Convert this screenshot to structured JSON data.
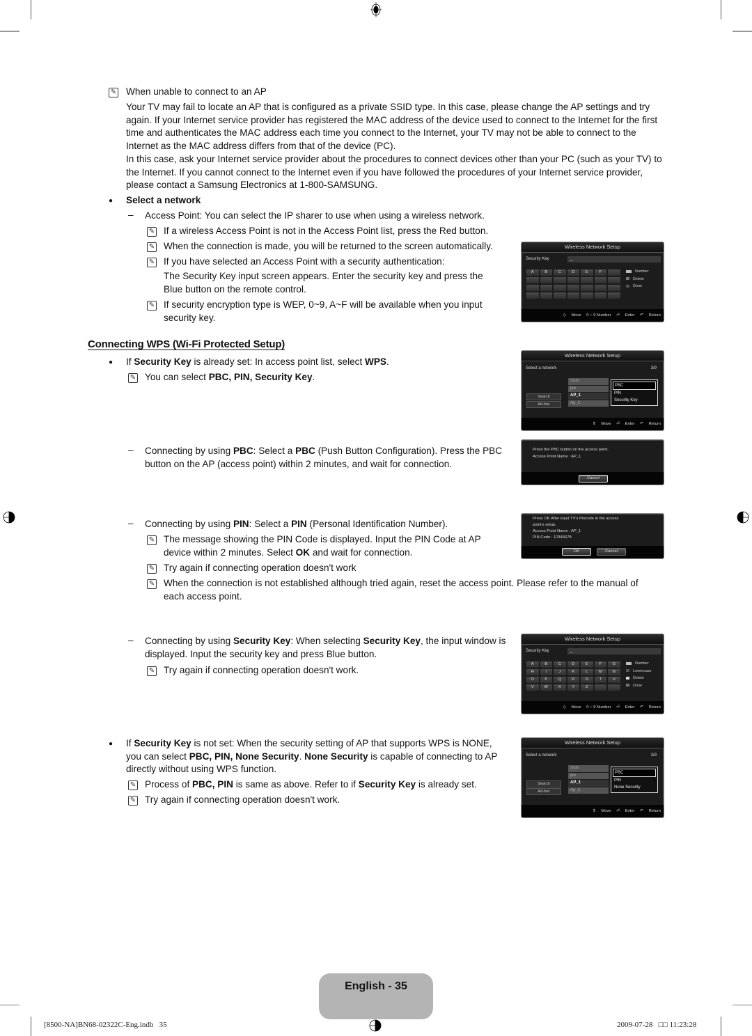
{
  "notes_top": {
    "ap_title": "When unable to connect to an AP",
    "ap_para1": "Your TV may fail to locate an AP that is configured as a private SSID type. In this case, please change the AP settings and try again. If your Internet service provider has registered the MAC address of the device used to connect to the Internet for the first time and authenticates the MAC address each time you connect to the Internet, your TV may not be able to connect to the Internet as the MAC address differs from that of the device (PC).",
    "ap_para2": "In this case, ask your Internet service provider about the procedures to connect devices other than your PC (such as your TV) to the Internet. If you cannot connect to the Internet even if you have followed the procedures of your Internet service provider, please contact a Samsung Electronics at 1-800-SAMSUNG."
  },
  "select_network": {
    "heading": "Select a network",
    "access_point": "Access Point: You can select the IP sharer to use when using a wireless network.",
    "note1": "If a wireless Access Point is not in the Access Point list, press the Red button.",
    "note2": "When the connection is made, you will be returned to the screen automatically.",
    "note3": "If you have selected an Access Point with a security authentication:",
    "note3_detail": "The Security Key input screen appears. Enter the security key and press the Blue button on the remote control.",
    "note4": "If security encryption type is WEP, 0~9, A~F will be available when you input security key."
  },
  "wps": {
    "title": "Connecting WPS (Wi-Fi Protected Setup)",
    "bullet1_pre": "If ",
    "bullet1_b1": "Security Key",
    "bullet1_mid": " is already set: In access point list, select ",
    "bullet1_b2": "WPS",
    "bullet1_end": ".",
    "note_select_pre": "You can select ",
    "note_select_b": "PBC, PIN, Security Key",
    "note_select_end": ".",
    "pbc_pre": "Connecting by using ",
    "pbc_b1": "PBC",
    "pbc_mid": ": Select a ",
    "pbc_b2": "PBC",
    "pbc_end": " (Push Button Configuration). Press the PBC button on the AP (access point) within 2 minutes, and wait for connection.",
    "pin_pre": "Connecting by using ",
    "pin_b1": "PIN",
    "pin_mid": ": Select a ",
    "pin_b2": "PIN",
    "pin_end": " (Personal Identification Number).",
    "pin_note1_pre": "The message showing the PIN Code is displayed. Input the PIN Code at AP device within 2 minutes. Select ",
    "pin_note1_b": "OK",
    "pin_note1_end": " and wait for connection.",
    "pin_note2": "Try again if connecting operation doesn't work",
    "pin_note3": "When the connection is not established although tried again, reset the access point. Please refer to the manual of each access point.",
    "sk_pre": "Connecting by using ",
    "sk_b1": "Security Key",
    "sk_mid": ": When selecting ",
    "sk_b2": "Security Key",
    "sk_end": ", the input window is displayed. Input the security key and press Blue button.",
    "sk_note": "Try again if connecting operation doesn't work.",
    "bullet2_pre": "If ",
    "bullet2_b1": "Security Key",
    "bullet2_mid1": " is not set: When the security setting of AP that supports WPS is NONE, you can select ",
    "bullet2_b2": "PBC, PIN, None Security",
    "bullet2_mid2": ". ",
    "bullet2_b3": "None Security",
    "bullet2_end": " is capable of connecting to AP directly without using WPS function.",
    "b2_note1_pre": "Process of ",
    "b2_note1_b1": "PBC, PIN",
    "b2_note1_mid": " is same as above. Refer to if ",
    "b2_note1_b2": "Security Key",
    "b2_note1_end": " is already set.",
    "b2_note2": "Try again if connecting operation doesn't work."
  },
  "tv_panels": {
    "window_title": "Wireless Network Setup",
    "security_key_label": "Security Key",
    "security_key_value": "_",
    "hex_keys": [
      "A",
      "B",
      "C",
      "D",
      "E",
      "F",
      "",
      "",
      "",
      "",
      "",
      "",
      "",
      "",
      "",
      "",
      "",
      "",
      "",
      "",
      "",
      "",
      "",
      "",
      "",
      "",
      "",
      "",
      ""
    ],
    "alpha_keys": [
      "A",
      "B",
      "C",
      "D",
      "E",
      "F",
      "G",
      "H",
      "I",
      "J",
      "K",
      "L",
      "M",
      "N",
      "O",
      "P",
      "Q",
      "R",
      "S",
      "T",
      "U",
      "V",
      "W",
      "X",
      "Y",
      "Z",
      "",
      ""
    ],
    "legend_hex": [
      "Number",
      "Delete",
      "Done"
    ],
    "legend_alpha": [
      "Number",
      "Lowercase",
      "Delete",
      "Done"
    ],
    "footer_keyboard": {
      "move": "Move",
      "number": "0 ~ 9 Number",
      "enter": "Enter",
      "return": "Return"
    },
    "footer_list": {
      "move": "Move",
      "enter": "Enter",
      "return": "Return"
    },
    "select_label": "Select a network",
    "page_count": "3/9",
    "networks": [
      "sson",
      "jee",
      "AP_1",
      "Ap_2"
    ],
    "search_btn": "Search",
    "adhoc_btn": "Ad-hoc",
    "popup_wps": [
      "PBC",
      "PIN",
      "Security Key"
    ],
    "popup_none": [
      "PBC",
      "PIN",
      "None Security"
    ],
    "pbc_msg1": "Press the PBC button on the access point.",
    "pbc_msg2": "Access Point Name : AP_1",
    "cancel": "Cancel",
    "ok": "OK",
    "pin_msg1": "Press OK After input TV's Pincode in the access",
    "pin_msg2": "point's setup.",
    "pin_msg3": "Access Point Name : AP_1",
    "pin_msg4": "PIN Code : 12345678"
  },
  "page_footer": {
    "page_label": "English - 35",
    "file": "[8500-NA]BN68-02322C-Eng.indb   35",
    "datetime": "2009-07-28   □□ 11:23:28"
  }
}
